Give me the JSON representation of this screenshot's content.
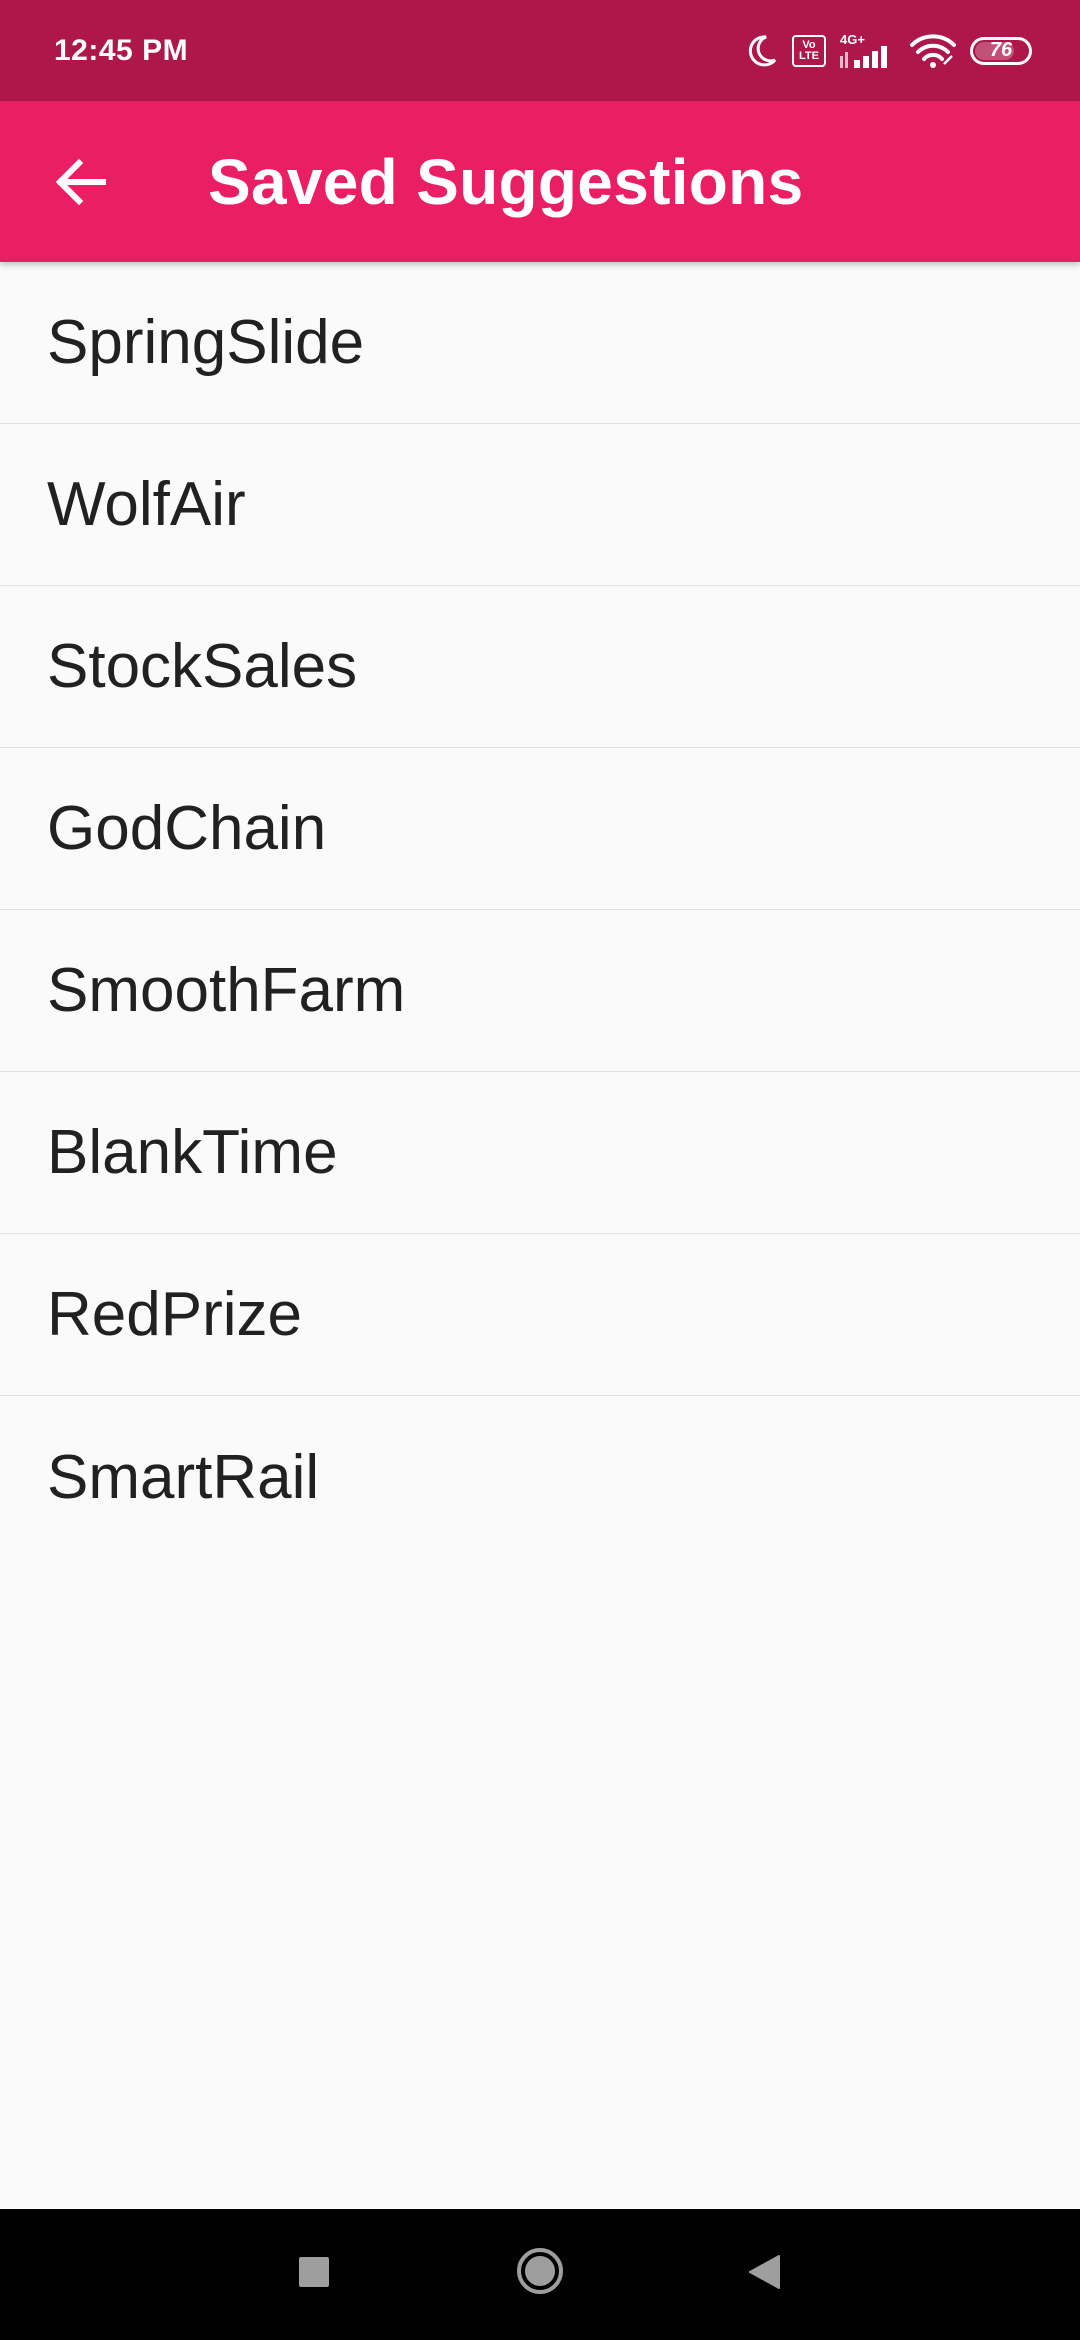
{
  "status_bar": {
    "time": "12:45 PM",
    "volte_top": "Vo",
    "volte_bottom": "LTE",
    "network_type": "4G+",
    "battery_level": "76",
    "battery_fraction": 0.76,
    "icons": [
      "moon-icon",
      "volte-icon",
      "signal-icon",
      "wifi-icon",
      "battery-icon"
    ]
  },
  "app_bar": {
    "title": "Saved Suggestions",
    "color": "#e91e63",
    "back_icon": "arrow-back-icon"
  },
  "list": {
    "items": [
      "SpringSlide",
      "WolfAir",
      "StockSales",
      "GodChain",
      "SmoothFarm",
      "BlankTime",
      "RedPrize",
      "SmartRail"
    ]
  },
  "nav_bar": {
    "icons": [
      "recents-square-icon",
      "home-circle-icon",
      "back-triangle-icon"
    ]
  }
}
